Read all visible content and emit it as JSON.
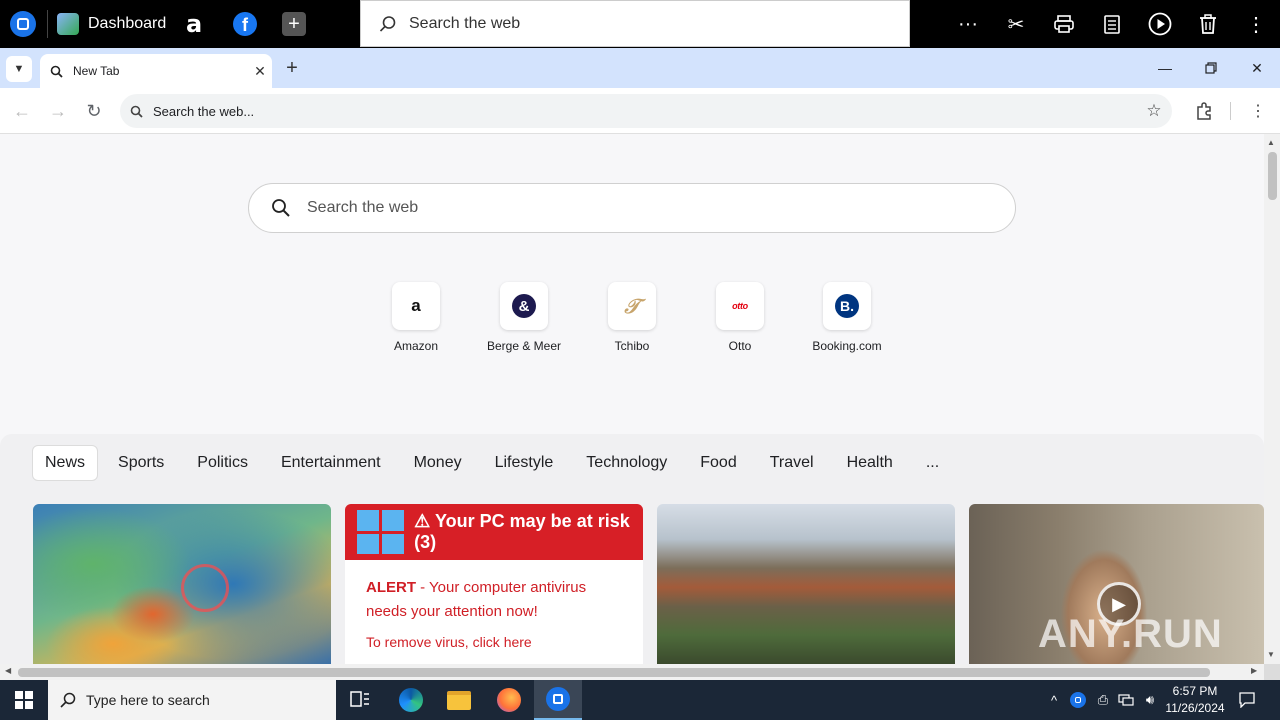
{
  "appbar": {
    "dashboard_label": "Dashboard",
    "search_placeholder": "Search the web",
    "icons": [
      "app-logo-icon",
      "dashboard-icon",
      "amazon-icon",
      "facebook-icon",
      "add-icon",
      "more-dots-icon",
      "scissors-icon",
      "print-icon",
      "notes-icon",
      "play-icon",
      "trash-icon",
      "kebab-icon"
    ]
  },
  "browser": {
    "tab_title": "New Tab",
    "address_placeholder": "Search the web..."
  },
  "newtab": {
    "search_placeholder": "Search the web",
    "shortcuts": [
      {
        "label": "Amazon",
        "glyph": "a"
      },
      {
        "label": "Berge & Meer",
        "glyph": "&"
      },
      {
        "label": "Tchibo",
        "glyph": "𝒯"
      },
      {
        "label": "Otto",
        "glyph": "otto"
      },
      {
        "label": "Booking.com",
        "glyph": "B."
      }
    ],
    "categories": [
      "News",
      "Sports",
      "Politics",
      "Entertainment",
      "Money",
      "Lifestyle",
      "Technology",
      "Food",
      "Travel",
      "Health",
      "..."
    ],
    "active_category": "News",
    "ad_card": {
      "title": "Your PC may be at risk (3)",
      "alert_strong": "ALERT",
      "alert_text": " - Your computer antivirus needs your attention now!",
      "remove_text": "To remove virus, click here"
    },
    "watermark": "ANY.RUN"
  },
  "taskbar": {
    "search_placeholder": "Type here to search",
    "time": "6:57 PM",
    "date": "11/26/2024"
  },
  "colors": {
    "accent": "#1a73e8",
    "tabstrip": "#d3e3fd",
    "ad_red": "#d71f26",
    "taskbar": "#1b2737"
  }
}
